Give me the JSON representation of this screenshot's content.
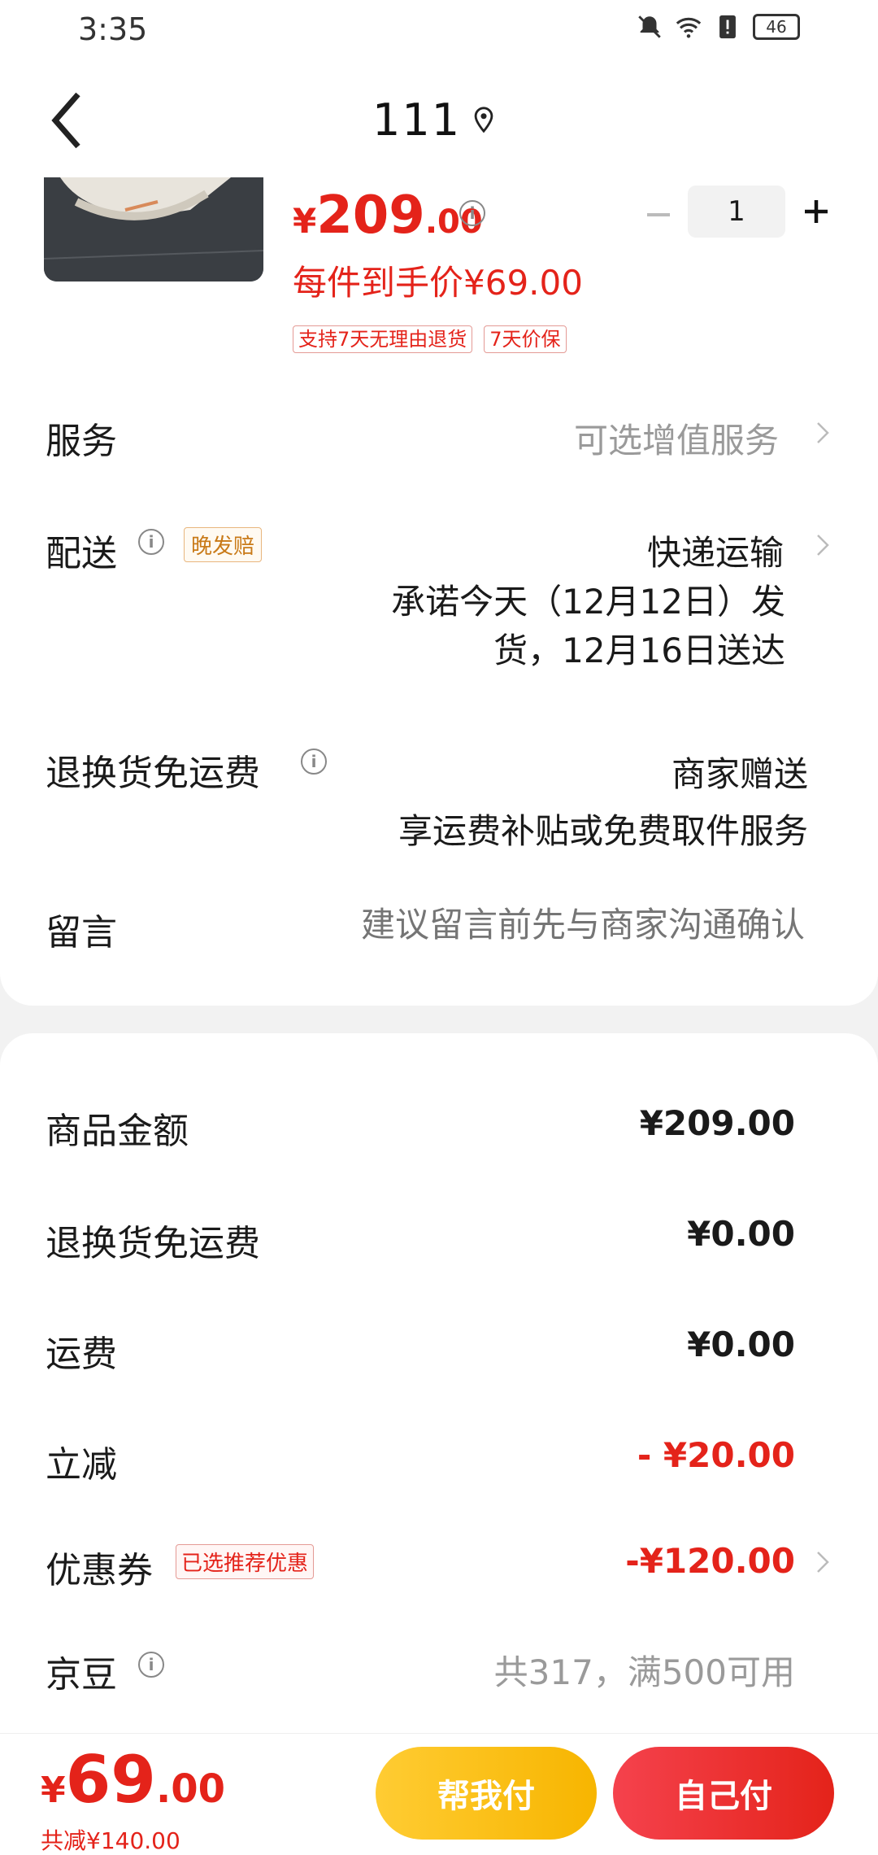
{
  "status_bar": {
    "time": "3:35",
    "battery": "46"
  },
  "header": {
    "title": "111"
  },
  "product": {
    "price_symbol": "¥",
    "price_int": "209",
    "price_dec": ".00",
    "quantity": "1",
    "unit_price": "每件到手价¥69.00",
    "tags": [
      "支持7天无理由退货",
      "7天价保"
    ]
  },
  "service": {
    "label": "服务",
    "value": "可选增值服务"
  },
  "delivery": {
    "label": "配送",
    "badge": "晚发赔",
    "method": "快递运输",
    "promise": "承诺今天（12月12日）发货，12月16日送达"
  },
  "return_shipping": {
    "label": "退换货免运费",
    "value": "商家赠送",
    "sub": "享运费补贴或免费取件服务"
  },
  "message": {
    "label": "留言",
    "placeholder": "建议留言前先与商家沟通确认"
  },
  "summary": {
    "goods_label": "商品金额",
    "goods_value": "¥209.00",
    "return_label": "退换货免运费",
    "return_value": "¥0.00",
    "freight_label": "运费",
    "freight_value": "¥0.00",
    "discount_label": "立减",
    "discount_value": "- ¥20.00",
    "coupon_label": "优惠券",
    "coupon_badge": "已选推荐优惠",
    "coupon_value": "-¥120.00",
    "jd_label": "京豆",
    "jd_value": "共317，满500可用"
  },
  "footer": {
    "price_symbol": "¥",
    "price_int": "69",
    "price_dec": ".00",
    "saved": "共减¥140.00",
    "help_pay": "帮我付",
    "self_pay": "自己付"
  },
  "colors": {
    "accent": "#e4231a",
    "yellow": "#f7b500"
  }
}
